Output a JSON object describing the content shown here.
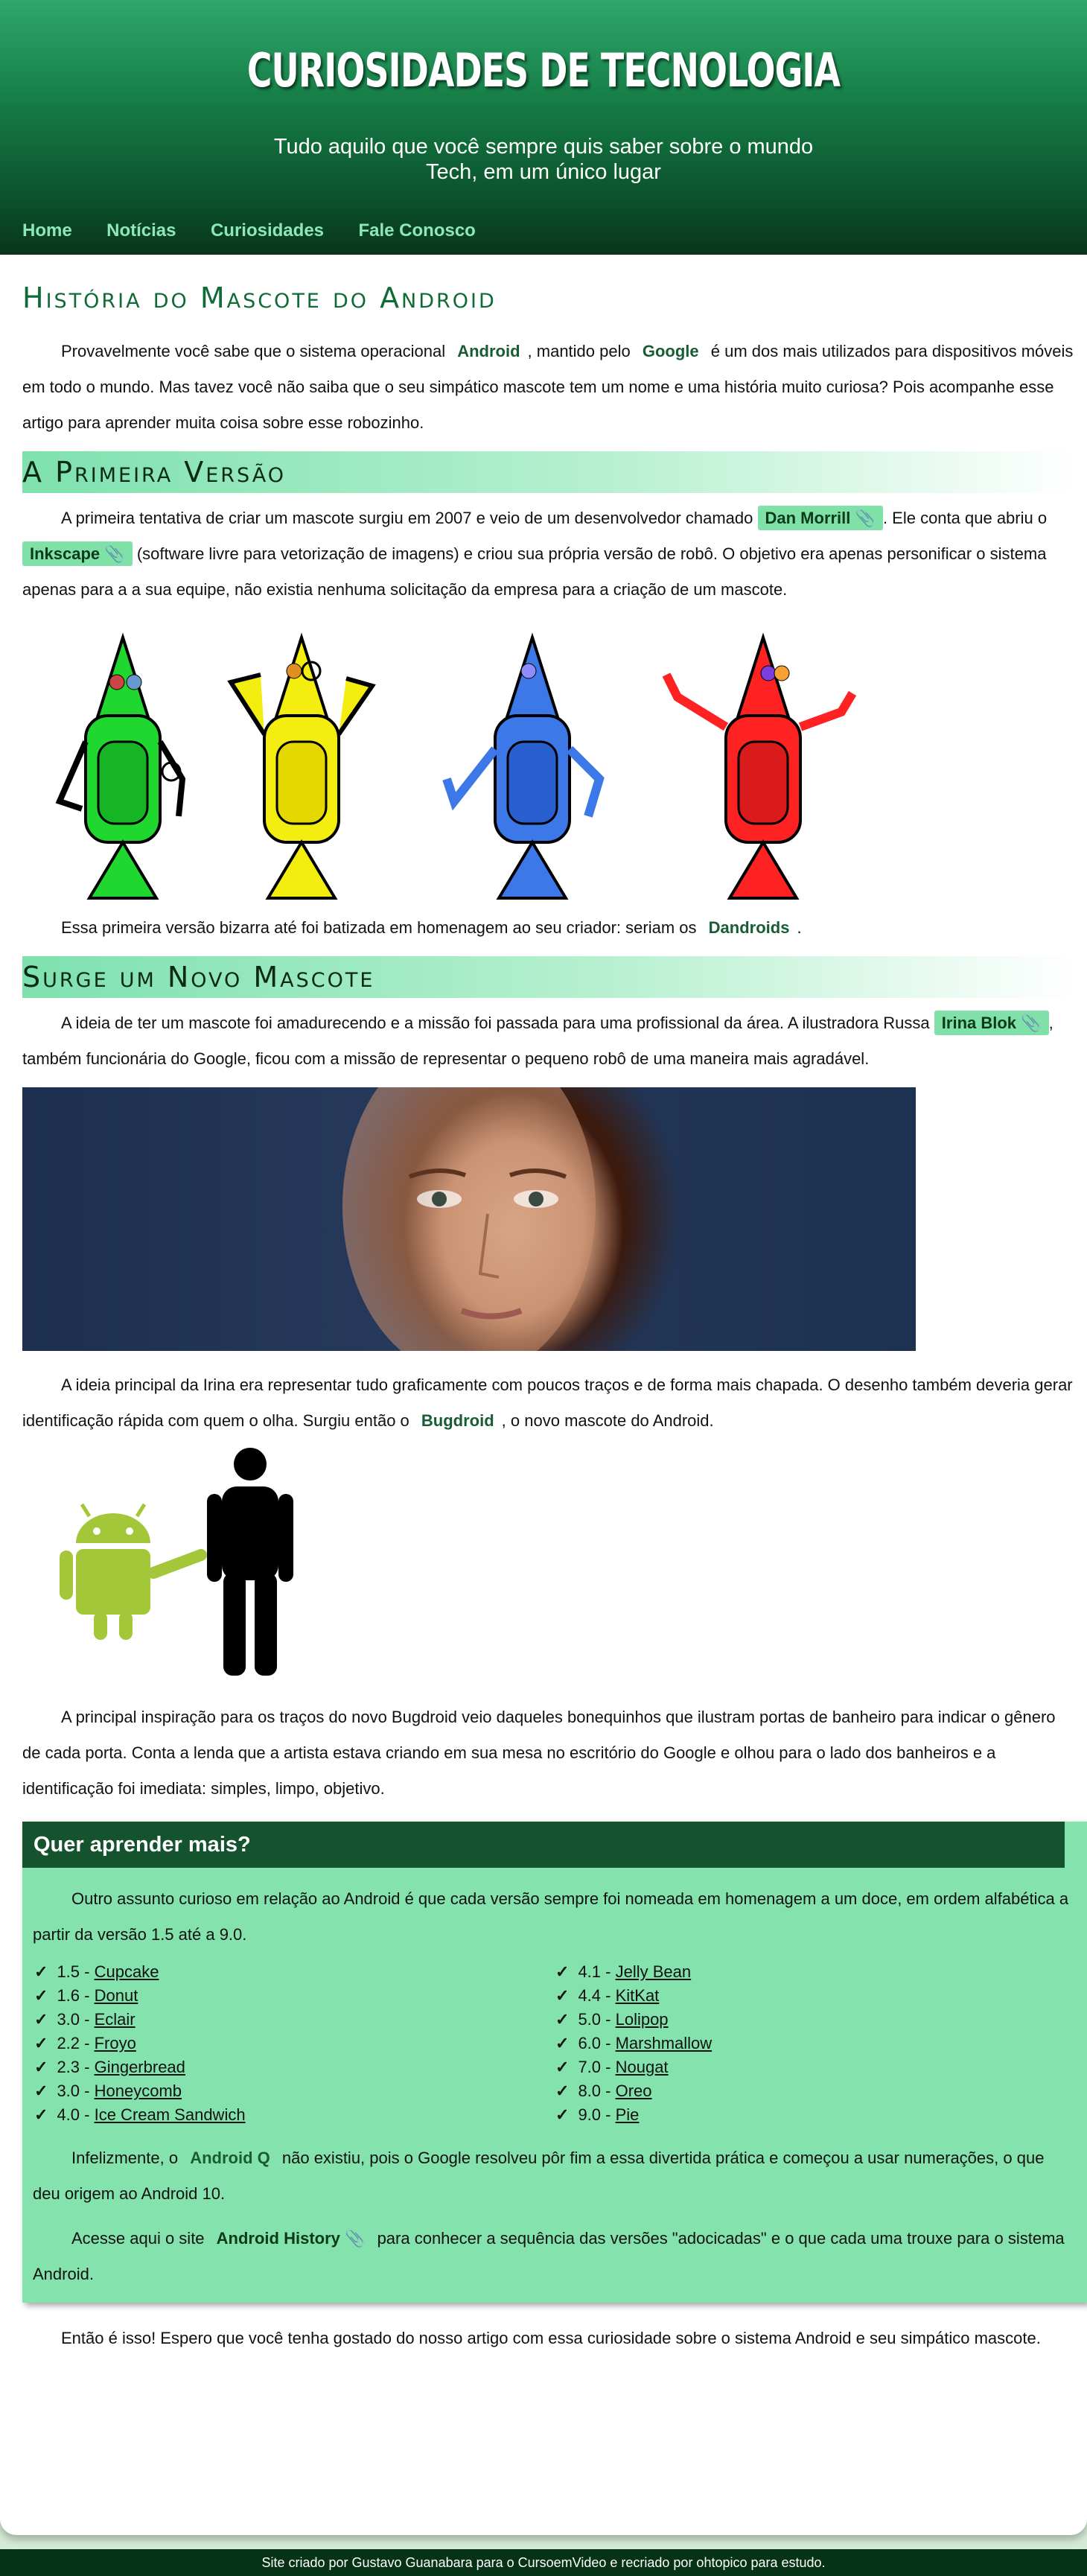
{
  "header": {
    "title": "CURIOSIDADES DE TECNOLOGIA",
    "subtitle_1": "Tudo aquilo que você sempre quis saber sobre o mundo",
    "subtitle_2": "Tech, em um único lugar",
    "nav": [
      "Home",
      "Notícias",
      "Curiosidades",
      "Fale Conosco"
    ]
  },
  "article": {
    "title": "História do Mascote do Android",
    "intro": {
      "a": "Provavelmente você sabe que o sistema operacional",
      "kw1": "Android",
      "b": ", mantido pelo",
      "kw2": "Google",
      "c": "é um dos mais utilizados para dispositivos móveis em todo o mundo. Mas tavez você não saiba que o seu simpático mascote tem um nome e uma história muito curiosa? Pois acompanhe esse artigo para aprender muita coisa sobre esse robozinho."
    },
    "section1": {
      "title": "A Primeira Versão",
      "p1a": "A primeira tentativa de criar um mascote surgiu em 2007 e veio de um desenvolvedor chamado",
      "link1": "Dan Morrill",
      "p1b": ". Ele conta que abriu o",
      "link2": "Inkscape",
      "p1c": "(software livre para vetorização de imagens) e criou sua própria versão de robô. O objetivo era apenas personificar o sistema apenas para a a sua equipe, não existia nenhuma solicitação da empresa para a criação de um mascote.",
      "p2a": "Essa primeira versão bizarra até foi batizada em homenagem ao seu criador: seriam os",
      "kw": "Dandroids",
      "p2b": "."
    },
    "section2": {
      "title": "Surge um Novo Mascote",
      "p1a": "A ideia de ter um mascote foi amadurecendo e a missão foi passada para uma profissional da área. A ilustradora Russa",
      "link": "Irina Blok",
      "p1b": ", também funcionária do Google, ficou com a missão de representar o pequeno robô de uma maneira mais agradável.",
      "p2a": "A ideia principal da Irina era representar tudo graficamente com poucos traços e de forma mais chapada. O desenho também deveria gerar identificação rápida com quem o olha. Surgiu então o",
      "kw": "Bugdroid",
      "p2b": ", o novo mascote do Android.",
      "p3": "A principal inspiração para os traços do novo Bugdroid veio daqueles bonequinhos que ilustram portas de banheiro para indicar o gênero de cada porta. Conta a lenda que a artista estava criando em sua mesa no escritório do Google e olhou para o lado dos banheiros e a identificação foi imediata: simples, limpo, objetivo."
    },
    "learn": {
      "title": "Quer aprender mais?",
      "p1": "Outro assunto curioso em relação ao Android é que cada versão sempre foi nomeada em homenagem a um doce, em ordem alfabética a partir da versão 1.5 até a 9.0.",
      "versions_left": [
        {
          "v": "1.5",
          "name": "Cupcake"
        },
        {
          "v": "1.6",
          "name": "Donut"
        },
        {
          "v": "3.0",
          "name": "Eclair"
        },
        {
          "v": "2.2",
          "name": "Froyo"
        },
        {
          "v": "2.3",
          "name": "Gingerbread"
        },
        {
          "v": "3.0",
          "name": "Honeycomb"
        },
        {
          "v": "4.0",
          "name": "Ice Cream Sandwich"
        }
      ],
      "versions_right": [
        {
          "v": "4.1",
          "name": "Jelly Bean"
        },
        {
          "v": "4.4",
          "name": "KitKat"
        },
        {
          "v": "5.0",
          "name": "Lolipop"
        },
        {
          "v": "6.0",
          "name": "Marshmallow"
        },
        {
          "v": "7.0",
          "name": "Nougat"
        },
        {
          "v": "8.0",
          "name": "Oreo"
        },
        {
          "v": "9.0",
          "name": "Pie"
        }
      ],
      "p2a": "Infelizmente, o",
      "kw": "Android Q",
      "p2b": "não existiu, pois o Google resolveu pôr fim a essa divertida prática e começou a usar numerações, o que deu origem ao Android 10.",
      "p3a": "Acesse aqui o site",
      "link": "Android History",
      "p3b": "para conhecer a sequência das versões \"adocicadas\" e o que cada uma trouxe para o sistema Android."
    },
    "closing": "Então é isso! Espero que você tenha gostado do nosso artigo com essa curiosidade sobre o sistema Android e seu simpático mascote."
  },
  "footer": {
    "text": "Site criado por Gustavo Guanabara para o CursoemVideo e recriado por ohtopico para estudo."
  },
  "colors": {
    "header_top": "#2fa76a",
    "header_bottom": "#08361c",
    "nav_link": "#8ee8b6",
    "accent_green": "#0f6b35",
    "link_bg": "#7fe0a8",
    "learn_bg": "#84e3ad",
    "learn_title_bg": "#14532e",
    "footer_bg": "#063218",
    "android_green": "#a4c639"
  },
  "icons": [
    "paperclip-icon",
    "check-icon"
  ]
}
